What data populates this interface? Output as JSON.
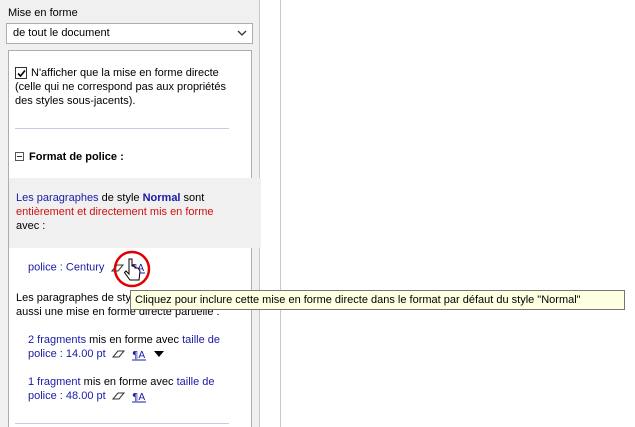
{
  "section_title": "Mise en forme",
  "scope_select": {
    "value": "de tout le document"
  },
  "option": {
    "line1": "N'afficher que la mise en forme directe",
    "line2": "(celle qui ne correspond pas aux propriétés",
    "line3": "des styles sous-jacents)."
  },
  "font_format": {
    "heading": "Format de police :",
    "para": {
      "les_paragraphes": "Les paragraphes",
      "de_style": " de style ",
      "style_name": "Normal",
      "sont": " sont",
      "entirely": "entièrement et directement mis en forme",
      "avec": "avec :"
    },
    "font_item": "police : Century",
    "para2_line1": "Les paragraphes de sty",
    "para2_line2": "aussi une  mise en forme directe partielle :",
    "fragments": [
      {
        "count": "2 fragments",
        "mid": " mis en forme avec ",
        "prop1": "taille de",
        "prop2": "police : 14.00 pt"
      },
      {
        "count": "1 fragment",
        "mid": " mis en forme avec ",
        "prop1": "taille de",
        "prop2": "police : 48.00 pt"
      }
    ]
  },
  "tooltip": "Cliquez pour inclure cette mise en forme directe dans le format par défaut du style \"Normal\"",
  "colors": {
    "link_blue": "#1a1aa6",
    "red": "#d01010",
    "tooltip_bg": "#ffffe1",
    "highlight_circle": "#e00000"
  }
}
